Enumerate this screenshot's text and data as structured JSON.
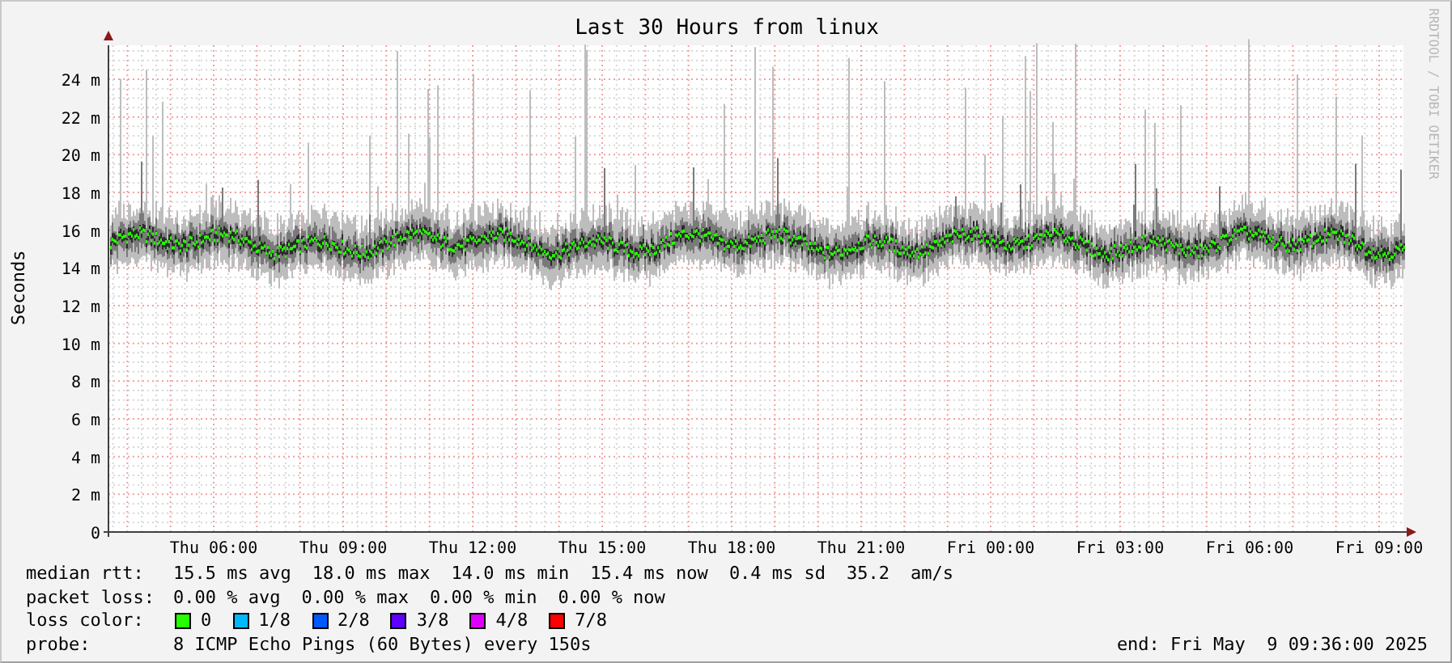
{
  "title": "Last 30 Hours from linux",
  "side_label": "RRDTOOL / TOBI OETIKER",
  "y_axis": {
    "label": "Seconds",
    "ticks": [
      "24 m",
      "22 m",
      "20 m",
      "18 m",
      "16 m",
      "14 m",
      "12 m",
      "10 m",
      "8 m",
      "6 m",
      "4 m",
      "2 m",
      "0"
    ]
  },
  "x_axis": {
    "ticks": [
      "Thu 06:00",
      "Thu 09:00",
      "Thu 12:00",
      "Thu 15:00",
      "Thu 18:00",
      "Thu 21:00",
      "Fri 00:00",
      "Fri 03:00",
      "Fri 06:00",
      "Fri 09:00"
    ]
  },
  "legend": {
    "rows": [
      {
        "label": "median rtt:",
        "values": [
          "15.5 ms avg",
          "18.0 ms max",
          "14.0 ms min",
          "15.4 ms now",
          "0.4 ms sd",
          "35.2",
          "am/s"
        ]
      },
      {
        "label": "packet loss:",
        "values": [
          "0.00 % avg",
          "0.00 % max",
          "0.00 % min",
          "0.00 % now"
        ]
      }
    ],
    "loss_color": {
      "label": "loss color:",
      "items": [
        {
          "label": "0",
          "color": "#26ff00"
        },
        {
          "label": "1/8",
          "color": "#00b8ff"
        },
        {
          "label": "2/8",
          "color": "#0059ff"
        },
        {
          "label": "3/8",
          "color": "#5e00ff"
        },
        {
          "label": "4/8",
          "color": "#dd00ff"
        },
        {
          "label": "7/8",
          "color": "#ff0000"
        }
      ]
    },
    "probe": {
      "label": "probe:",
      "value": "8 ICMP Echo Pings (60 Bytes) every 150s"
    },
    "end": "end: Fri May  9 09:36:00 2025"
  }
}
